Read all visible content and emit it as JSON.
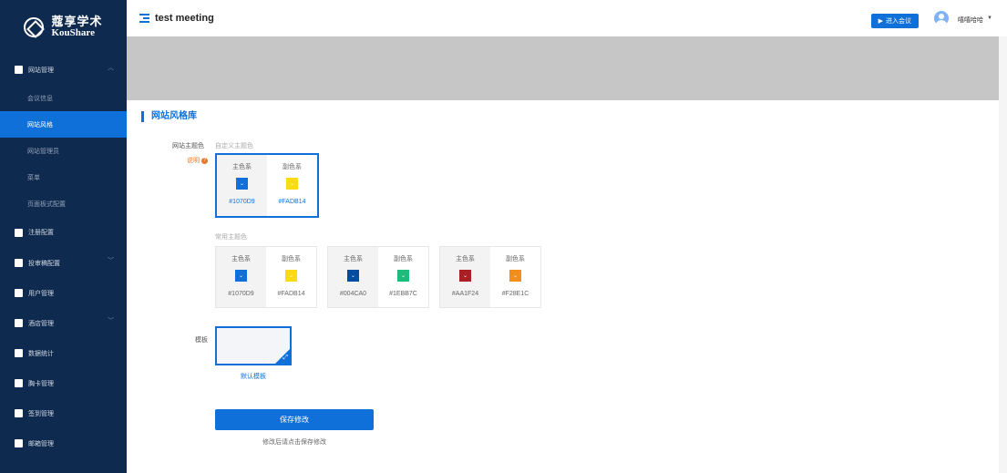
{
  "logo": {
    "cn": "蔻享学术",
    "en": "KouShare"
  },
  "sidebar": {
    "group_site": "网站管理",
    "sub_items": [
      {
        "label": "会议信息"
      },
      {
        "label": "网站风格"
      },
      {
        "label": "网站管理员"
      },
      {
        "label": "菜单"
      },
      {
        "label": "页面板式配置"
      }
    ],
    "groups": [
      {
        "label": "注册配置"
      },
      {
        "label": "投审稿配置"
      },
      {
        "label": "用户管理"
      },
      {
        "label": "酒店管理"
      },
      {
        "label": "数据统计"
      },
      {
        "label": "胸卡管理"
      },
      {
        "label": "签到管理"
      },
      {
        "label": "邮箱管理"
      }
    ],
    "active_index": 1
  },
  "header": {
    "title": "test meeting",
    "enter_button": "进入会议",
    "user_name": "嘻嘻哈哈"
  },
  "main": {
    "section_title": "网站风格库",
    "theme_label": "网站主题色",
    "custom_theme": "自定义主题色",
    "note_label": "说明",
    "common_label": "常用主题色",
    "primary_label": "主色系",
    "secondary_label": "副色系",
    "selected_theme": {
      "primary": "#1070D9",
      "secondary": "#FADB14"
    },
    "common_themes": [
      {
        "primary": "#1070D9",
        "secondary": "#FADB14"
      },
      {
        "primary": "#004CA0",
        "secondary": "#1EBB7C"
      },
      {
        "primary": "#AA1F24",
        "secondary": "#F28E1C"
      }
    ],
    "template_label": "模板",
    "template_name": "默认模板",
    "save_button": "保存修改",
    "save_hint": "修改后请点击保存修改"
  },
  "colors": {
    "accent": "#1070d9",
    "sidebar_bg": "#0f2a4f",
    "note": "#e6792d"
  }
}
